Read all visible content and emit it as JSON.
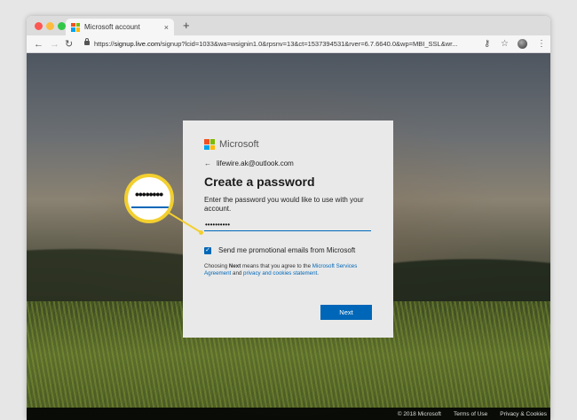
{
  "browser": {
    "tab_title": "Microsoft account",
    "tab_close": "×",
    "new_tab": "+",
    "url_prefix": "https://",
    "url_host": "signup.live.com",
    "url_rest": "/signup?lcid=1033&wa=wsignin1.0&rpsnv=13&ct=1537394531&rver=6.7.6640.0&wp=MBI_SSL&wr..."
  },
  "signup": {
    "brand": "Microsoft",
    "back_arrow": "←",
    "identity": "lifewire.ak@outlook.com",
    "heading": "Create a password",
    "description": "Enter the password you would like to use with your account.",
    "password_value": "••••••••••",
    "checkbox_checked": true,
    "checkbox_mark": "✓",
    "checkbox_label": "Send me promotional emails from Microsoft",
    "legal_prefix": "Choosing ",
    "legal_bold": "Next",
    "legal_mid": " means that you agree to the ",
    "legal_link1": "Microsoft Services Agreement",
    "legal_and": " and ",
    "legal_link2": "privacy and cookies statement",
    "legal_end": ".",
    "next_label": "Next"
  },
  "callout": {
    "magnified_text": "••••••••"
  },
  "footer": {
    "copyright": "© 2018 Microsoft",
    "terms": "Terms of Use",
    "privacy": "Privacy & Cookies"
  },
  "colors": {
    "ms_red": "#f25022",
    "ms_green": "#7fba00",
    "ms_blue": "#00a4ef",
    "ms_yellow": "#ffb900",
    "accent": "#0067b8",
    "callout": "#f2cf2f"
  }
}
